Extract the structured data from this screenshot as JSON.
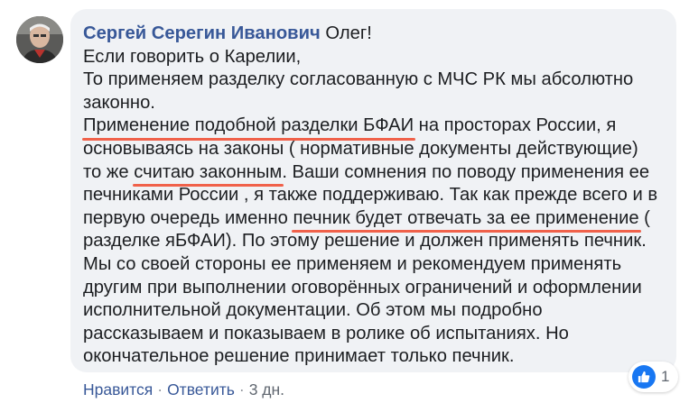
{
  "comment": {
    "author": "Сергей Серегин Иванович",
    "lines": [
      {
        "segments": [
          {
            "text": " Олег!",
            "hl": false
          }
        ]
      },
      {
        "segments": [
          {
            "text": "Если говорить о Карелии,",
            "hl": false
          }
        ]
      },
      {
        "segments": [
          {
            "text": "То применяем разделку согласованную с МЧС РК мы абсолютно",
            "hl": false
          }
        ]
      },
      {
        "segments": [
          {
            "text": "законно.",
            "hl": false
          }
        ]
      },
      {
        "segments": [
          {
            "text": "Применение подобной разделки БФАИ",
            "hl": true
          },
          {
            "text": " на просторах России, я",
            "hl": false
          }
        ]
      },
      {
        "segments": [
          {
            "text": "основываясь на законы ( нормативные документы действующие)",
            "hl": false
          }
        ]
      },
      {
        "segments": [
          {
            "text": "то же ",
            "hl": false
          },
          {
            "text": "считаю законным",
            "hl": true
          },
          {
            "text": ". Ваши сомнения по поводу применения ее",
            "hl": false
          }
        ]
      },
      {
        "segments": [
          {
            "text": "печниками России , я также поддерживаю. Так как прежде всего и в",
            "hl": false
          }
        ]
      },
      {
        "segments": [
          {
            "text": "первую очередь именно ",
            "hl": false
          },
          {
            "text": "печник будет отвечать за ее применение",
            "hl": true
          },
          {
            "text": " (",
            "hl": false
          }
        ]
      },
      {
        "segments": [
          {
            "text": "разделке яБФАИ). По этому решение и должен применять печник.",
            "hl": false
          }
        ]
      },
      {
        "segments": [
          {
            "text": "Мы со своей стороны ее применяем и рекомендуем применять",
            "hl": false
          }
        ]
      },
      {
        "segments": [
          {
            "text": "другим при выполнении оговорённых ограничений и оформлении",
            "hl": false
          }
        ]
      },
      {
        "segments": [
          {
            "text": "исполнительной документации. Об этом мы подробно",
            "hl": false
          }
        ]
      },
      {
        "segments": [
          {
            "text": "рассказываем и показываем в ролике об испытаниях. Но",
            "hl": false
          }
        ]
      },
      {
        "segments": [
          {
            "text": "окончательное решение принимает только печник.",
            "hl": false
          }
        ]
      }
    ]
  },
  "reactions": {
    "icon": "like-icon",
    "count": "1"
  },
  "actions": {
    "like_label": "Нравится",
    "reply_label": "Ответить",
    "separator": "·",
    "time": "3 дн."
  },
  "colors": {
    "author": "#385898",
    "bubble": "#f0f2f5",
    "highlight": "#f0614a",
    "like": "#1877f2"
  }
}
